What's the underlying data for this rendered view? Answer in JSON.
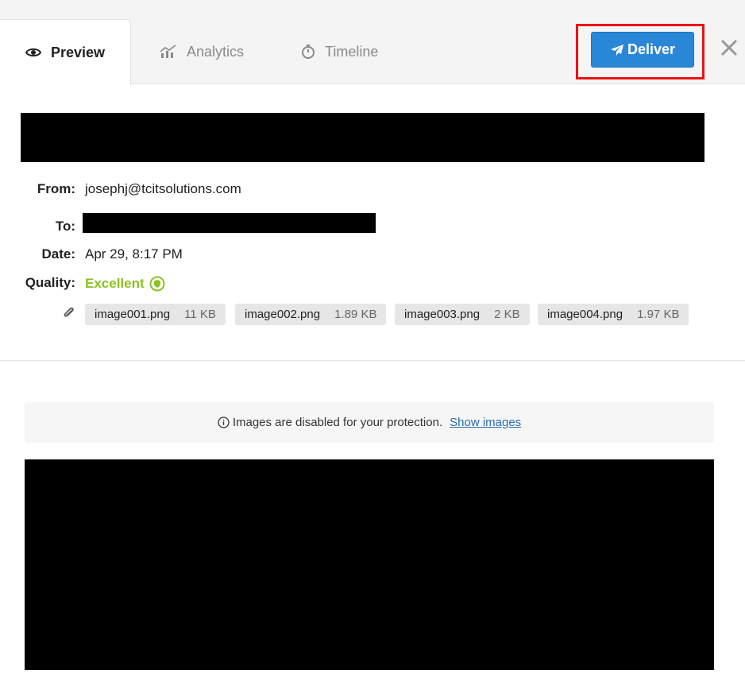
{
  "tabs": [
    {
      "label": "Preview",
      "icon": "eye-icon",
      "active": true
    },
    {
      "label": "Analytics",
      "icon": "analytics-chart-icon",
      "active": false
    },
    {
      "label": "Timeline",
      "icon": "stopwatch-icon",
      "active": false
    }
  ],
  "toolbar": {
    "deliver_label": "Deliver",
    "deliver_icon": "paper-plane-icon",
    "close_icon": "close-icon"
  },
  "message": {
    "from_label": "From:",
    "from_value": "josephj@tcitsolutions.com",
    "to_label": "To:",
    "date_label": "Date:",
    "date_value": "Apr 29, 8:17 PM",
    "quality_label": "Quality:",
    "quality_value": "Excellent"
  },
  "attachments": [
    {
      "name": "image001.png",
      "size": "11 KB"
    },
    {
      "name": "image002.png",
      "size": "1.89 KB"
    },
    {
      "name": "image003.png",
      "size": "2 KB"
    },
    {
      "name": "image004.png",
      "size": "1.97 KB"
    }
  ],
  "notice": {
    "text": "Images are disabled for your protection.",
    "link": "Show images"
  },
  "colors": {
    "accent": "#2a87d8",
    "quality": "#8cc222",
    "highlight": "#ee1111"
  }
}
